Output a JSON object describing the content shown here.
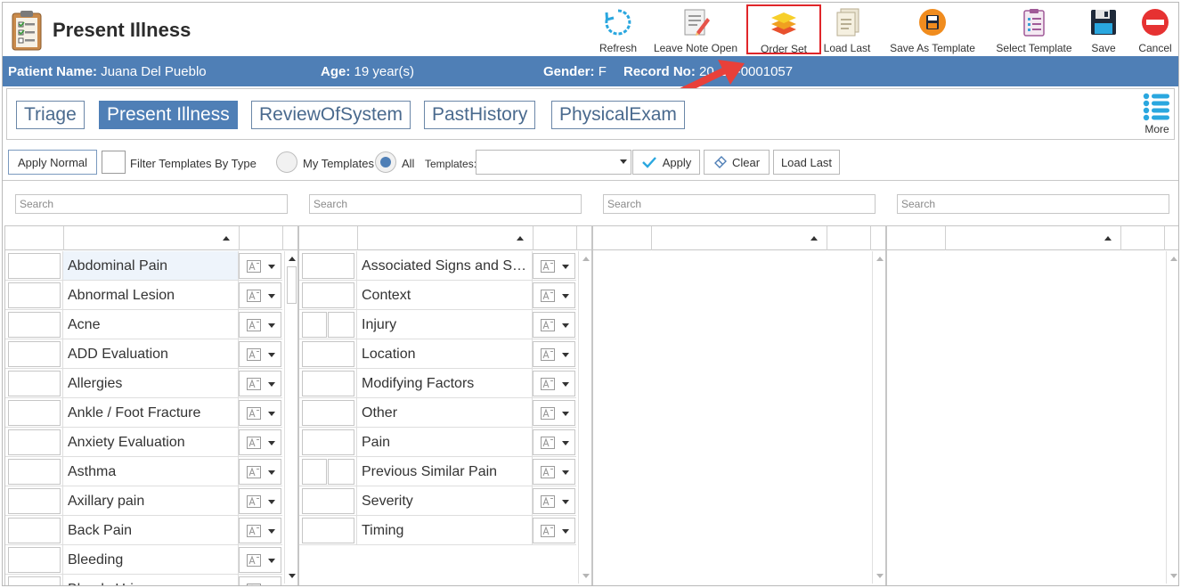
{
  "page": {
    "title": "Present Illness"
  },
  "toolbar": {
    "refresh": "Refresh",
    "leave_note_open": "Leave Note Open",
    "order_set": "Order Set",
    "load_last": "Load Last",
    "save_as_template": "Save As Template",
    "select_template": "Select Template",
    "save": "Save",
    "cancel": "Cancel"
  },
  "patient": {
    "name_label": "Patient Name:",
    "name": "Juana Del Pueblo",
    "age_label": "Age:",
    "age": "19 year(s)",
    "gender_label": "Gender:",
    "gender": "F",
    "record_label": "Record No:",
    "record": "20  10-0001057"
  },
  "tabs": [
    "Triage",
    "Present Illness",
    "ReviewOfSystem",
    "PastHistory",
    "PhysicalExam"
  ],
  "more_label": "More",
  "filters": {
    "apply_normal": "Apply Normal",
    "filter_by_type": "Filter Templates By Type",
    "my_templates": "My Templates",
    "all": "All",
    "templates_label": "Templates:",
    "templates_value": "",
    "apply": "Apply",
    "clear": "Clear",
    "load_last": "Load Last"
  },
  "search_placeholder": "Search",
  "panel1": {
    "items": [
      "Abdominal Pain",
      "Abnormal Lesion",
      "Acne",
      "ADD Evaluation",
      "Allergies",
      "Ankle / Foot Fracture",
      "Anxiety Evaluation",
      "Asthma",
      "Axillary pain",
      "Back Pain",
      "Bleeding",
      "Bloody Urine"
    ]
  },
  "panel2": {
    "items": [
      "Associated Signs and Symptoms",
      "Context",
      "Injury",
      "Location",
      "Modifying Factors",
      "Other",
      "Pain",
      "Previous Similar Pain",
      "Severity",
      "Timing"
    ]
  },
  "colors": {
    "accent": "#4f7fb6",
    "highlight": "#e0262a",
    "arrow": "#e8403a"
  }
}
